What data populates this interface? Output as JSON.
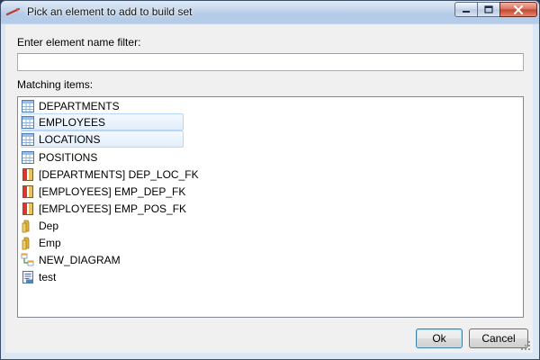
{
  "window": {
    "title": "Pick an element to add to build set",
    "controls": {
      "minimize_icon": "minimize-icon",
      "maximize_icon": "maximize-icon",
      "close_icon": "close-icon"
    }
  },
  "filter": {
    "label": "Enter element name filter:",
    "value": "",
    "placeholder": ""
  },
  "list": {
    "label": "Matching items:",
    "items": [
      {
        "label": "DEPARTMENTS",
        "icon": "table-icon",
        "selected": false
      },
      {
        "label": "EMPLOYEES",
        "icon": "table-icon",
        "selected": true
      },
      {
        "label": "LOCATIONS",
        "icon": "table-icon",
        "selected": true
      },
      {
        "label": "POSITIONS",
        "icon": "table-icon",
        "selected": false
      },
      {
        "label": "[DEPARTMENTS] DEP_LOC_FK",
        "icon": "foreign-key-icon",
        "selected": false
      },
      {
        "label": "[EMPLOYEES] EMP_DEP_FK",
        "icon": "foreign-key-icon",
        "selected": false
      },
      {
        "label": "[EMPLOYEES] EMP_POS_FK",
        "icon": "foreign-key-icon",
        "selected": false
      },
      {
        "label": "Dep",
        "icon": "folder-icon",
        "selected": false
      },
      {
        "label": "Emp",
        "icon": "folder-icon",
        "selected": false
      },
      {
        "label": "NEW_DIAGRAM",
        "icon": "diagram-icon",
        "selected": false
      },
      {
        "label": "test",
        "icon": "script-icon",
        "selected": false
      }
    ]
  },
  "buttons": {
    "ok": "Ok",
    "cancel": "Cancel"
  },
  "colors": {
    "selection_border": "#b8d6fb",
    "title_bar": "#b9d0ea",
    "close_button": "#c1432b"
  }
}
